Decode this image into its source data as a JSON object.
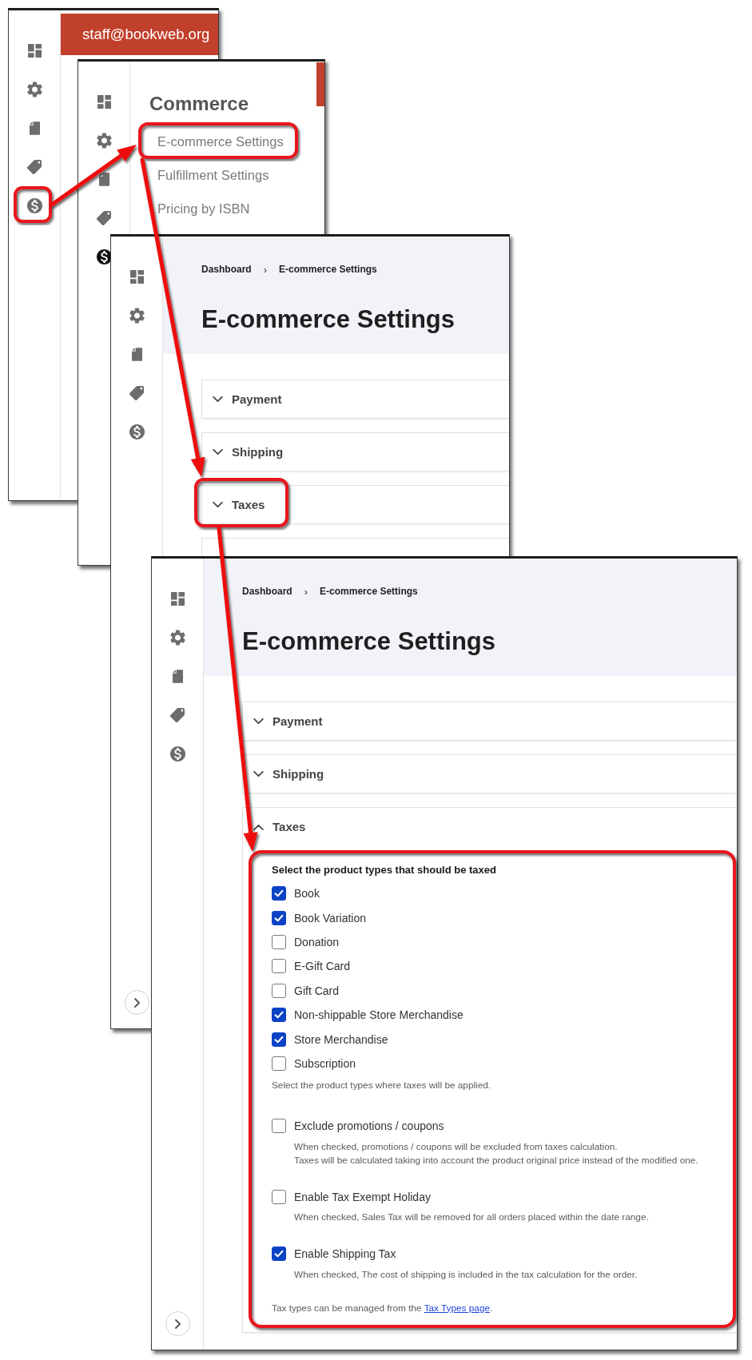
{
  "panels": [
    {
      "kind": "account",
      "email": "staff@bookweb.org",
      "sidebar": [
        {
          "selected": false
        },
        {
          "selected": false
        },
        {
          "selected": false
        },
        {
          "selected": false
        },
        {
          "selected": false
        }
      ]
    },
    {
      "kind": "menu",
      "sidebar": [
        {
          "selected": false
        },
        {
          "selected": false
        },
        {
          "selected": false
        },
        {
          "selected": false
        },
        {
          "selected": true
        }
      ],
      "menu": {
        "title": "Commerce",
        "items": [
          "E-commerce Settings",
          "Fulfillment Settings",
          "Pricing by ISBN"
        ]
      }
    },
    {
      "kind": "settings",
      "sidebar": [
        {
          "selected": false
        },
        {
          "selected": false
        },
        {
          "selected": false
        },
        {
          "selected": false
        },
        {
          "selected": false
        }
      ],
      "breadcrumb": [
        "Dashboard",
        "E-commerce Settings"
      ],
      "separator": "›",
      "title": "E-commerce Settings",
      "sections": [
        {
          "label": "Payment",
          "expanded": false,
          "covered": false
        },
        {
          "label": "Shipping",
          "expanded": false,
          "covered": false
        },
        {
          "label": "Taxes",
          "expanded": false,
          "covered": false
        },
        {
          "covered": true
        }
      ]
    },
    {
      "kind": "settings",
      "sidebar": [
        {
          "selected": false
        },
        {
          "selected": false
        },
        {
          "selected": false
        },
        {
          "selected": false
        },
        {
          "selected": false
        }
      ],
      "breadcrumb": [
        "Dashboard",
        "E-commerce Settings"
      ],
      "separator": "›",
      "title": "E-commerce Settings",
      "sections": [
        {
          "label": "Payment",
          "expanded": false,
          "covered": false
        },
        {
          "label": "Shipping",
          "expanded": false,
          "covered": false
        },
        {
          "label": "Taxes",
          "expanded": true,
          "covered": false,
          "content": {
            "heading": "Select the product types that should be taxed",
            "options": [
              {
                "label": "Book",
                "checked": true
              },
              {
                "label": "Book Variation",
                "checked": true
              },
              {
                "label": "Donation",
                "checked": false
              },
              {
                "label": "E-Gift Card",
                "checked": false
              },
              {
                "label": "Gift Card",
                "checked": false
              },
              {
                "label": "Non-shippable Store Merchandise",
                "checked": true
              },
              {
                "label": "Store Merchandise",
                "checked": true
              },
              {
                "label": "Subscription",
                "checked": false
              }
            ],
            "help": "Select the product types where taxes will be applied.",
            "settings": [
              {
                "label": "Exclude promotions / coupons",
                "checked": false,
                "description": [
                  "When checked, promotions / coupons will be excluded from taxes calculation.",
                  "Taxes will be calculated taking into account the product original price instead of the modified one."
                ]
              },
              {
                "label": "Enable Tax Exempt Holiday",
                "checked": false,
                "description": [
                  "When checked, Sales Tax will be removed for all orders placed within the date range."
                ]
              },
              {
                "label": "Enable Shipping Tax",
                "checked": true,
                "description": [
                  "When checked, The cost of shipping is included in the tax calculation for the order."
                ]
              }
            ],
            "note": {
              "text": "Tax types can be managed from the ",
              "link": "Tax Types page",
              "end": "."
            }
          }
        }
      ]
    }
  ]
}
